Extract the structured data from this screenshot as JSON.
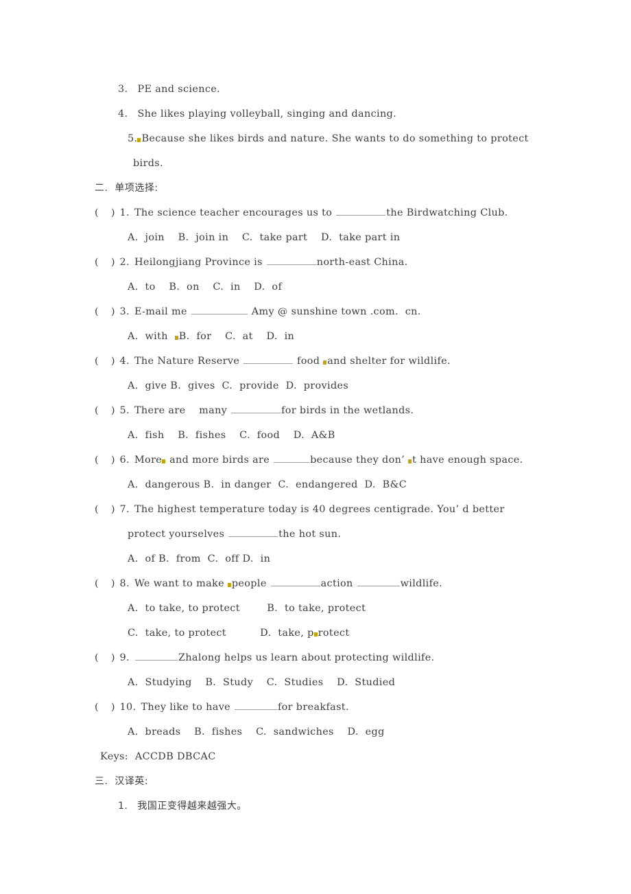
{
  "document": {
    "section_one_tail": {
      "items": [
        {
          "num": "3.",
          "text": "PE and science."
        },
        {
          "num": "4.",
          "text": "She likes playing volleyball, singing and dancing."
        },
        {
          "num": "5.",
          "mark": true,
          "text": "Because she likes birds and nature. She wants to do something to protect",
          "cont": "birds."
        }
      ]
    },
    "section_two": {
      "heading": "二.  单项选择:",
      "bracket": "(    )",
      "questions": [
        {
          "num": "1.",
          "stem_pre": "The science teacher encourages us to ",
          "stem_post": "the Birdwatching Club.",
          "blank": "b-l",
          "options": "A.  join    B.  join in    C.  take part    D.  take part in"
        },
        {
          "num": "2.",
          "stem_pre": "Heilongjiang Province is ",
          "stem_post": "north-east China.",
          "blank": "b-l",
          "options": "A.  to    B.  on    C.  in    D.  of"
        },
        {
          "num": "3.",
          "stem_pre": "E-mail me ",
          "stem_post": " Amy @ sunshine town .com.  cn.",
          "blank": "b-xl",
          "options": "A.  with     B.  for    C.  at    D.  in",
          "options_mark_before": "B."
        },
        {
          "num": "4.",
          "stem_pre": "The Nature Reserve ",
          "stem_mid": " food ",
          "stem_post": "and shelter for wildlife.",
          "blank": "b-l",
          "mark_mid": true,
          "options": "A.  give B.  gives  C.  provide  D.  provides"
        },
        {
          "num": "5.",
          "stem_pre": "There are    many ",
          "stem_post": "for birds in the wetlands.",
          "blank": "b-l",
          "options": "A.  fish    B.  fishes    C.  food    D.  A&B"
        },
        {
          "num": "6.",
          "stem_pre": "More",
          "stem_mid": " and more birds are ",
          "stem_post": "because they don’ ",
          "stem_tail": "t have enough space.",
          "blank": "b-s",
          "mark_after_pre": true,
          "mark_tail": true,
          "options": "A.  dangerous B.  in danger  C.  endangered  D.  B&C"
        },
        {
          "num": "7.",
          "stem_pre": "The highest temperature today is 40 degrees centigrade. You’ d better",
          "cont_pre": "protect yourselves ",
          "cont_post": "the hot sun.",
          "blank": "b-l",
          "options": "A.  of B.  from  C.  off D.  in"
        },
        {
          "num": "8.",
          "stem_pre": "We want to make ",
          "stem_mid": "people ",
          "stem_post": "action ",
          "stem_tail": "wildlife.",
          "blank": "b-l",
          "blank2": "b-m",
          "mark_mid": true,
          "options_a": "A.  to take, to protect        B.  to take, protect",
          "options_b": "C.  take, to protect          D.  take, p",
          "options_b_tail": "rotect",
          "mark_opt_b": true
        },
        {
          "num": "9.",
          "stem_pre": " ",
          "stem_post": "Zhalong helps us learn about protecting wildlife.",
          "blank": "b-m",
          "options": "A.  Studying    B.  Study    C.  Studies    D.  Studied"
        },
        {
          "num": "10.",
          "stem_pre": "They like to have ",
          "stem_post": "for breakfast.",
          "blank": "b-m",
          "options": "A.  breads    B.  fishes    C.  sandwiches    D.  egg"
        }
      ],
      "keys": "Keys:  ACCDB DBCAC"
    },
    "section_three": {
      "heading": "三.  汉译英:",
      "items": [
        {
          "num": "1.",
          "text": "我国正变得越来越强大。"
        }
      ]
    }
  }
}
